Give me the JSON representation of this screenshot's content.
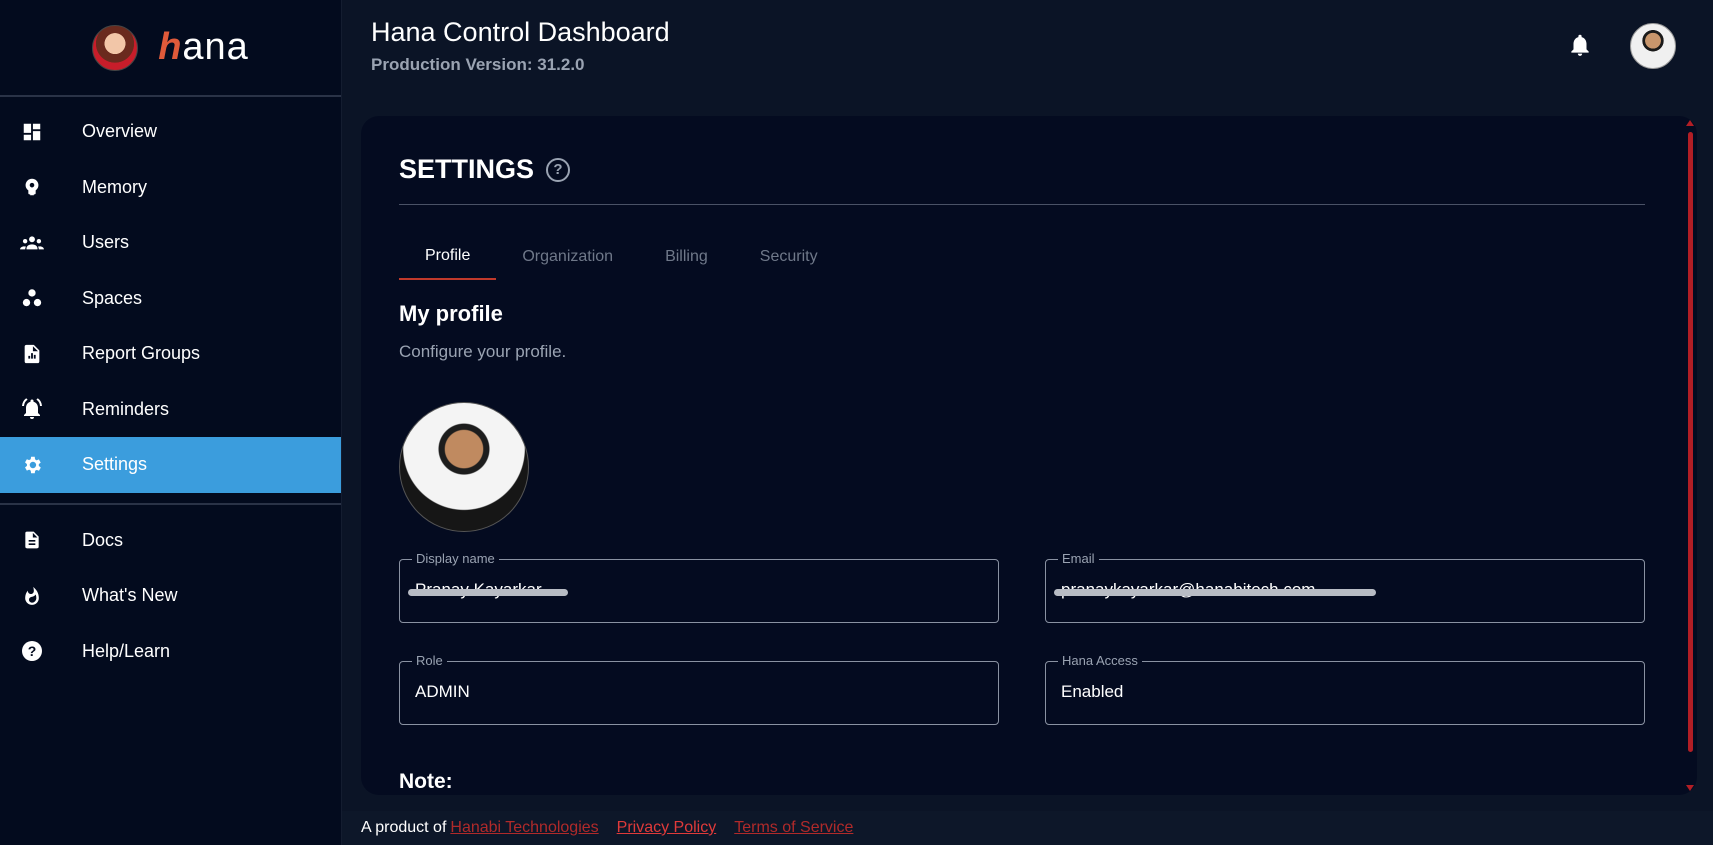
{
  "brand": {
    "name_suffix": "ana",
    "name_initial": "h"
  },
  "sidebar": {
    "items": [
      {
        "label": "Overview",
        "icon": "dashboard-icon"
      },
      {
        "label": "Memory",
        "icon": "brain-icon"
      },
      {
        "label": "Users",
        "icon": "users-icon"
      },
      {
        "label": "Spaces",
        "icon": "spaces-icon"
      },
      {
        "label": "Report Groups",
        "icon": "report-icon"
      },
      {
        "label": "Reminders",
        "icon": "alarm-icon"
      },
      {
        "label": "Settings",
        "icon": "gear-icon",
        "active": true
      }
    ],
    "secondary": [
      {
        "label": "Docs",
        "icon": "document-icon"
      },
      {
        "label": "What's New",
        "icon": "flame-icon"
      },
      {
        "label": "Help/Learn",
        "icon": "help-icon"
      }
    ]
  },
  "header": {
    "title": "Hana Control Dashboard",
    "version": "Production Version: 31.2.0"
  },
  "settings": {
    "title": "SETTINGS",
    "tabs": [
      "Profile",
      "Organization",
      "Billing",
      "Security"
    ],
    "active_tab": "Profile",
    "section_title": "My profile",
    "section_subtitle": "Configure your profile.",
    "fields": {
      "display_name": {
        "label": "Display name",
        "value": "Pranay Kayarkar"
      },
      "email": {
        "label": "Email",
        "value": "pranaykayarkar@hanabitech.com"
      },
      "role": {
        "label": "Role",
        "value": "ADMIN"
      },
      "hana_access": {
        "label": "Hana Access",
        "value": "Enabled"
      }
    },
    "note_label": "Note:"
  },
  "footer": {
    "prefix": "A product of",
    "company": "Hanabi Technologies",
    "privacy": "Privacy Policy",
    "terms": "Terms of Service"
  },
  "colors": {
    "accent": "#3b9ddd",
    "brand_red": "#c0392b",
    "background": "#0b1426"
  }
}
